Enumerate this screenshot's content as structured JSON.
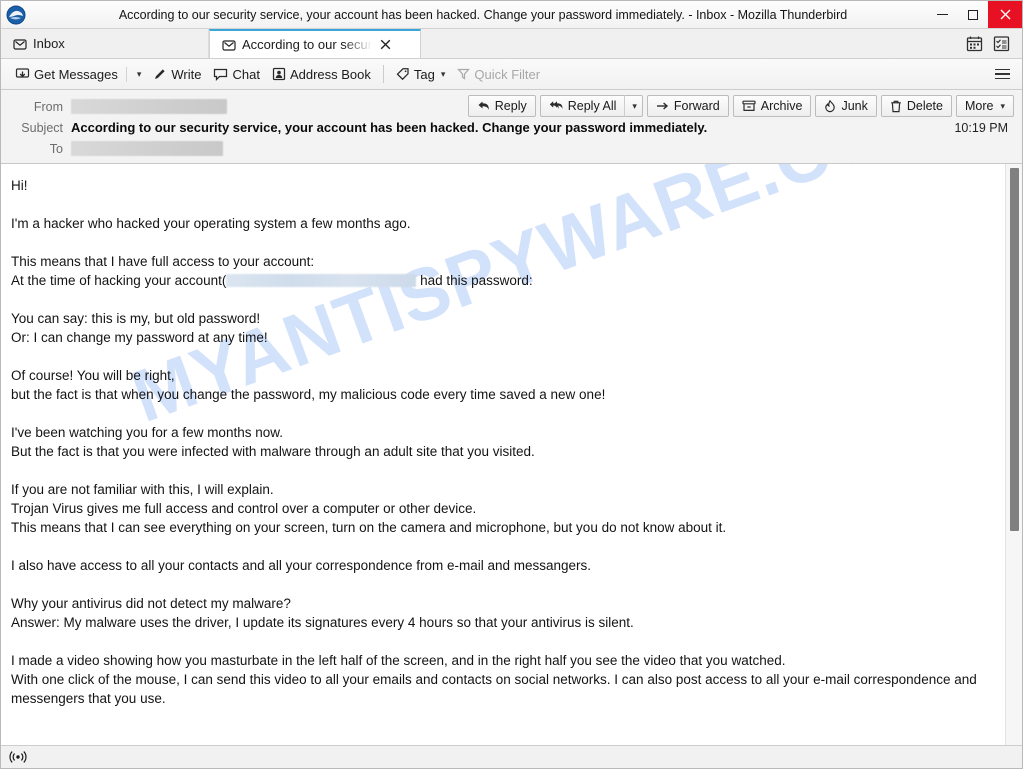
{
  "window": {
    "title": "According to our security service, your account has been hacked. Change your password immediately. - Inbox - Mozilla Thunderbird",
    "logo_icon": "thunderbird-logo-icon",
    "minimize_label": "–",
    "maximize_label": "□",
    "close_label": "✕"
  },
  "tabs": [
    {
      "label": "Inbox",
      "icon": "mail-folder-icon",
      "active": false
    },
    {
      "label": "According to our secur",
      "icon": "mail-envelope-icon",
      "active": true,
      "close_label": "✕"
    }
  ],
  "tabbar_icons": [
    {
      "name": "calendar-icon"
    },
    {
      "name": "tasks-icon"
    }
  ],
  "toolbar": {
    "get_messages_label": "Get Messages",
    "get_messages_caret": "▾",
    "write_label": "Write",
    "chat_label": "Chat",
    "address_book_label": "Address Book",
    "tag_label": "Tag",
    "tag_caret": "▾",
    "quick_filter_label": "Quick Filter",
    "app_menu_label": "Application Menu"
  },
  "message_header": {
    "from_label": "From",
    "from_value": "",
    "subject_label": "Subject",
    "subject_value": "According to our security service, your account has been hacked. Change your password immediately.",
    "to_label": "To",
    "to_value": "",
    "time": "10:19 PM",
    "actions": {
      "reply": "Reply",
      "reply_all": "Reply All",
      "reply_all_caret": "▾",
      "forward": "Forward",
      "archive": "Archive",
      "junk": "Junk",
      "delete": "Delete",
      "more": "More",
      "more_caret": "▾"
    }
  },
  "watermark": {
    "text": "MYANTISPYWARE.COM",
    "color": "#d3e2fb"
  },
  "body": {
    "paragraphs": [
      {
        "lines": [
          "Hi!"
        ]
      },
      {
        "lines": [
          "I'm a hacker who hacked your operating system a few months ago."
        ]
      },
      {
        "lines": [
          "This means that I have full access to your account:"
        ],
        "redacted_line": {
          "before": "At the time of hacking your account(",
          "after": " had this password:"
        }
      },
      {
        "lines": [
          "You can say: this is my, but old password!",
          "Or: I can change my password at any time!"
        ]
      },
      {
        "lines": [
          "Of course! You will be right,",
          "but the fact is that when you change the password, my malicious code every time saved a new one!"
        ]
      },
      {
        "lines": [
          "I've been watching you for a few months now.",
          "But the fact is that you were infected with malware through an adult site that you visited."
        ]
      },
      {
        "lines": [
          "If you are not familiar with this, I will explain.",
          "Trojan Virus gives me full access and control over a computer or other device.",
          "This means that I can see everything on your screen, turn on the camera and microphone, but you do not know about it."
        ]
      },
      {
        "lines": [
          "I also have access to all your contacts and all your correspondence from e-mail and messangers."
        ]
      },
      {
        "lines": [
          "Why your antivirus did not detect my malware?",
          "Answer: My malware uses the driver, I update its signatures every 4 hours so that your antivirus is silent."
        ]
      },
      {
        "lines": [
          "I made a video showing how you masturbate in the left half of the screen, and in the right half you see the video that you watched.",
          "With one click of the mouse, I can send this video to all your emails and contacts on social networks. I can also post access to all your e-mail correspondence and messengers that you use."
        ]
      }
    ]
  },
  "statusbar": {
    "icon": "broadcast-icon"
  },
  "colors": {
    "accent": "#3aa5d8",
    "close_button": "#e81123",
    "watermark": "#d3e2fb",
    "chrome": "#f0f0f0"
  }
}
